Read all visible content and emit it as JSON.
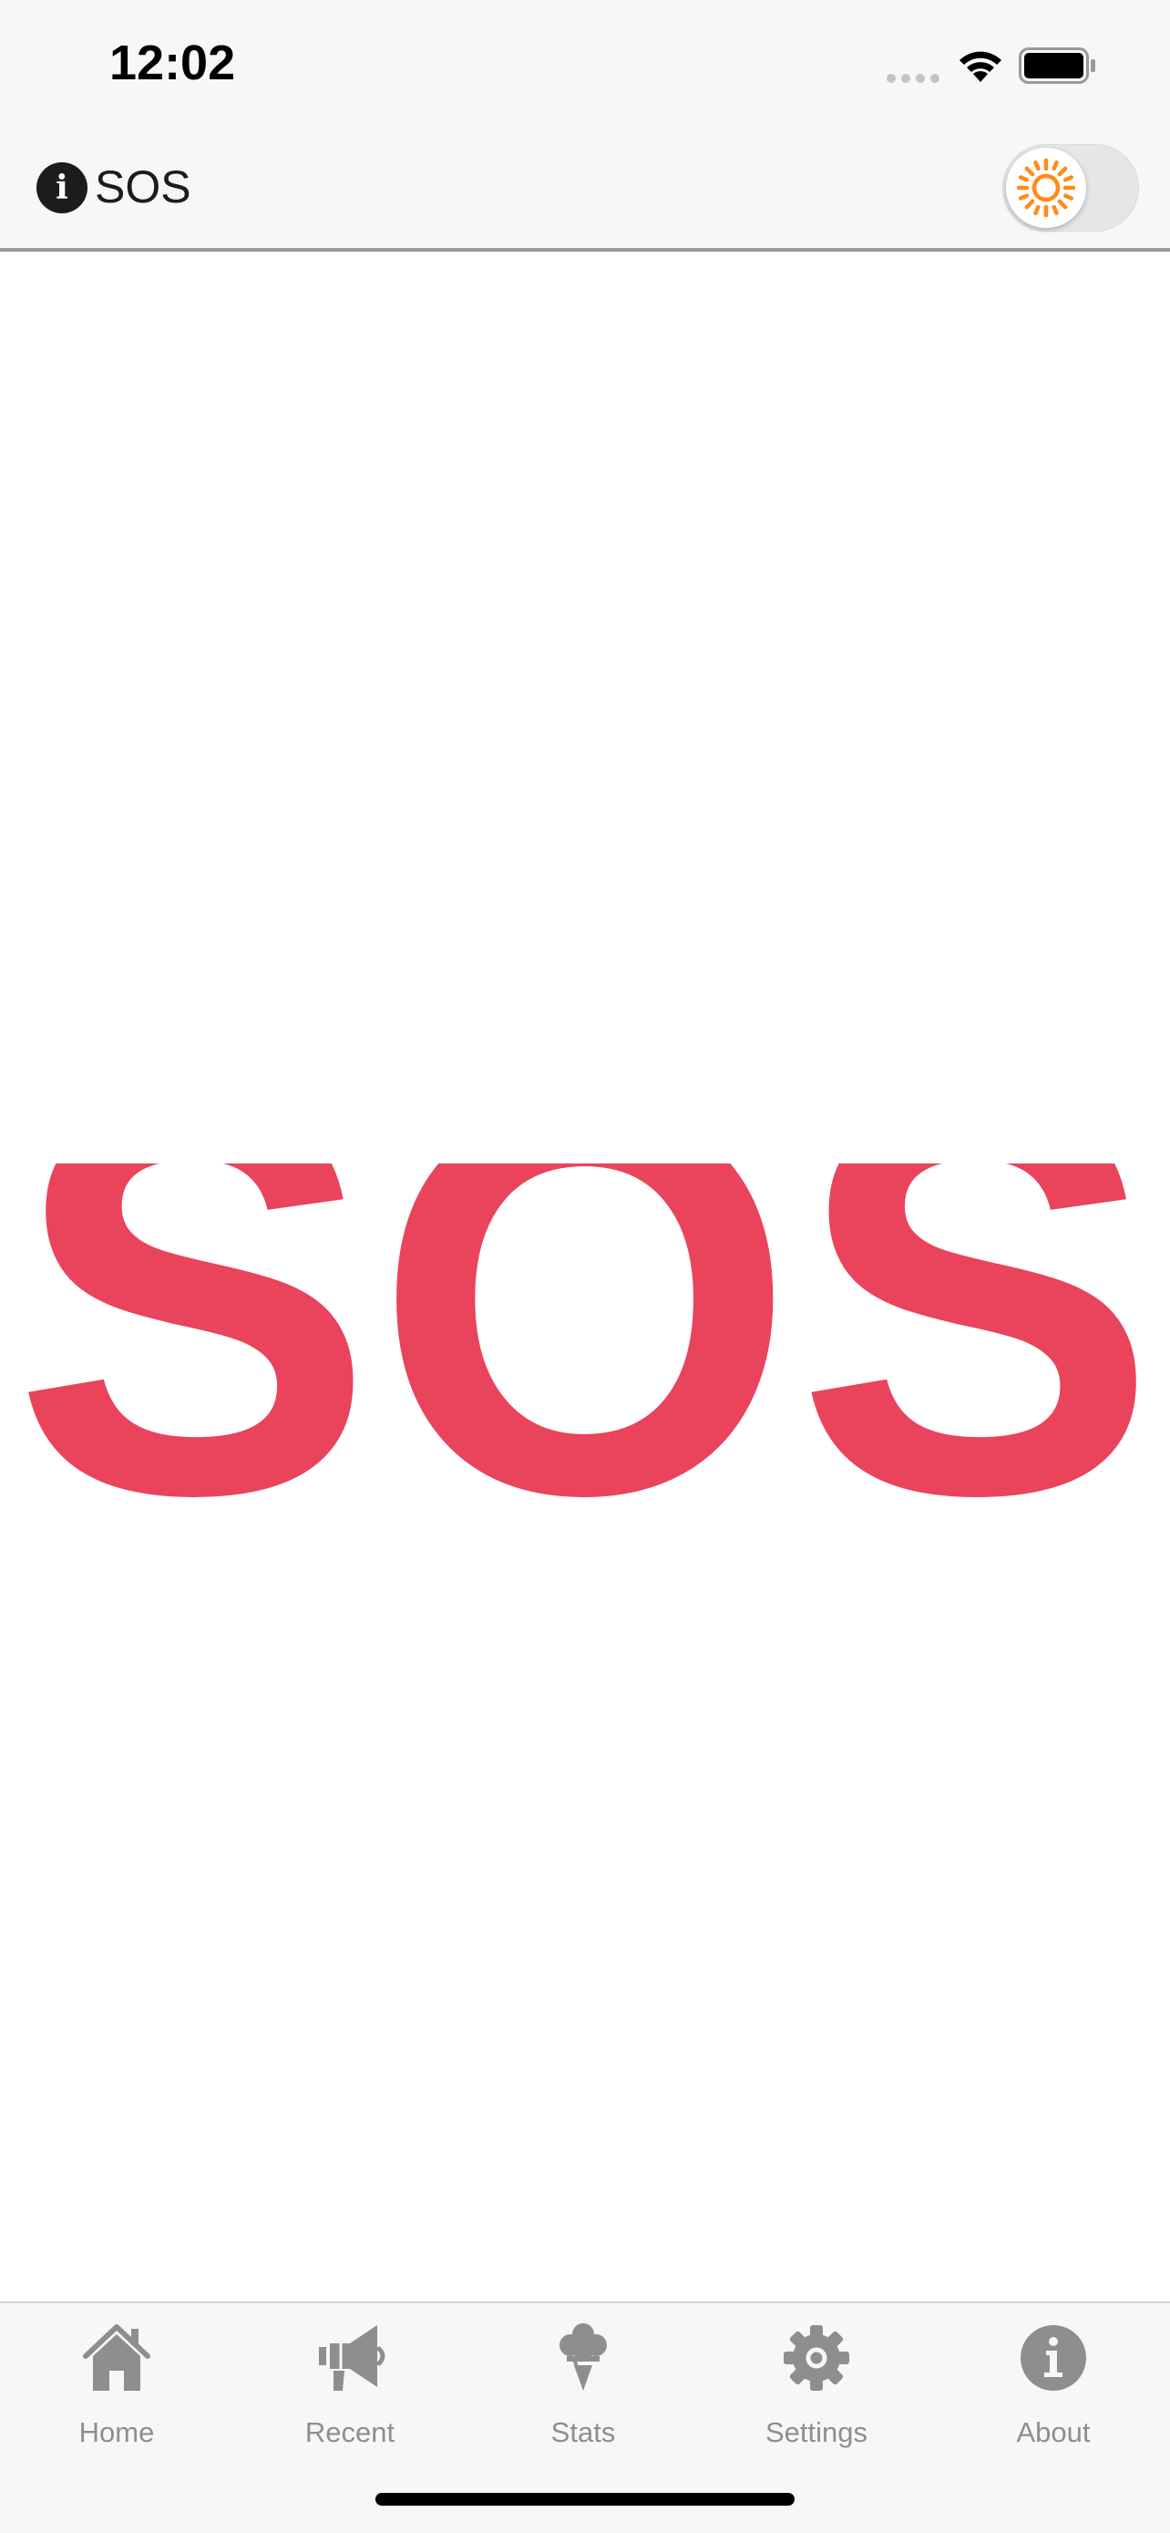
{
  "status_bar": {
    "time": "12:02"
  },
  "header": {
    "info_icon": "info-icon",
    "title": "SOS",
    "theme_toggle": {
      "icon": "sun-icon",
      "on": false,
      "icon_color": "#ff8c1a"
    }
  },
  "main": {
    "sos_text": "SOS",
    "sos_color": "#ea435c"
  },
  "tab_bar": {
    "tabs": [
      {
        "label": "Home",
        "icon": "home-icon"
      },
      {
        "label": "Recent",
        "icon": "megaphone-icon"
      },
      {
        "label": "Stats",
        "icon": "ice-cream-icon"
      },
      {
        "label": "Settings",
        "icon": "gear-icon"
      },
      {
        "label": "About",
        "icon": "info-icon"
      }
    ],
    "color": "#8e8e8e"
  }
}
